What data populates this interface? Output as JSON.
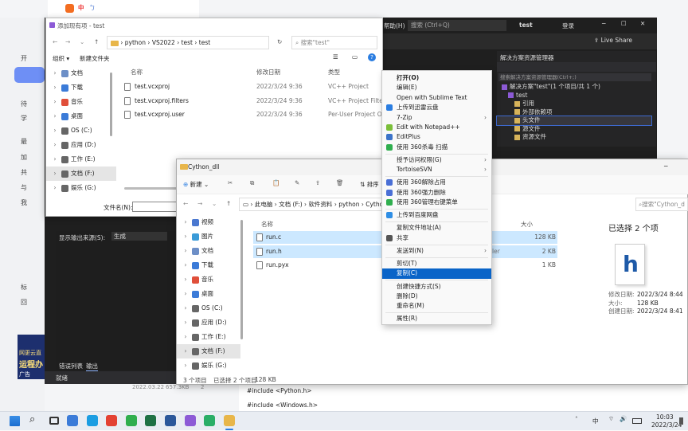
{
  "background_app": {
    "search_tab_labels": [
      "中",
      "ㄅ"
    ],
    "left_items": [
      "开",
      "待",
      "学",
      "最",
      "加",
      "共",
      "与",
      "我",
      "标",
      "回"
    ],
    "bottom_list": {
      "date": "2022.03.22",
      "size": "657.3KB",
      "count": "2"
    },
    "ad": {
      "line1": "网更云直",
      "line2": "运程办",
      "tag": "广告"
    },
    "code_lines": [
      "#include <Python.h>",
      "#include <Windows.h>"
    ]
  },
  "vs": {
    "menu_help": "帮助(H)",
    "search_placeholder": "搜索 (Ctrl+Q)",
    "solution_name": "test",
    "login": "登录",
    "live_share": "Live Share",
    "solution_explorer": {
      "title": "解决方案资源管理器",
      "search_placeholder": "搜索解决方案资源管理器(Ctrl+;)",
      "tree": [
        {
          "label": "解决方案\"test\"(1 个项目/共 1 个)",
          "indent": 0,
          "selected": false
        },
        {
          "label": "test",
          "indent": 1,
          "selected": false
        },
        {
          "label": "引用",
          "indent": 2,
          "selected": false
        },
        {
          "label": "外部依赖项",
          "indent": 2,
          "selected": false
        },
        {
          "label": "头文件",
          "indent": 2,
          "selected": true
        },
        {
          "label": "源文件",
          "indent": 2,
          "selected": false
        },
        {
          "label": "资源文件",
          "indent": 2,
          "selected": false
        }
      ]
    },
    "output": {
      "source_label": "显示输出来源(S):",
      "source_value": "生成",
      "tab_errors": "错误列表",
      "tab_output": "输出",
      "status": "就绪"
    }
  },
  "add_dialog": {
    "title": "添加现有项 - test",
    "path": [
      "python",
      "VS2022",
      "test",
      "test"
    ],
    "search_placeholder": "搜索\"test\"",
    "organize": "组织 ▾",
    "new_folder": "新建文件夹",
    "columns": {
      "name": "名称",
      "modified": "修改日期",
      "type": "类型"
    },
    "files": [
      {
        "name": "test.vcxproj",
        "modified": "2022/3/24 9:36",
        "type": "VC++ Project"
      },
      {
        "name": "test.vcxproj.filters",
        "modified": "2022/3/24 9:36",
        "type": "VC++ Project Filter..."
      },
      {
        "name": "test.vcxproj.user",
        "modified": "2022/3/24 9:36",
        "type": "Per-User Project O..."
      }
    ],
    "nav": [
      "文档",
      "下载",
      "音乐",
      "桌面",
      "OS (C:)",
      "应用 (D:)",
      "工作 (E:)",
      "文档 (F:)",
      "娱乐 (G:)"
    ],
    "filename_label": "文件名(N):"
  },
  "explorer": {
    "title": "Cython_dll",
    "new_label": "新建",
    "sort_label": "排序",
    "path": [
      "此电脑",
      "文档 (F:)",
      "软件资料",
      "python",
      "Cytho"
    ],
    "search_placeholder": "搜索\"Cython_d",
    "columns": {
      "name": "名称",
      "size": "大小"
    },
    "files": [
      {
        "name": "run.c",
        "size": "128 KB",
        "type": "",
        "selected": true
      },
      {
        "name": "run.h",
        "size": "2 KB",
        "type": "ler",
        "selected": true
      },
      {
        "name": "run.pyx",
        "size": "1 KB",
        "type": "",
        "selected": false
      }
    ],
    "nav": [
      "视频",
      "图片",
      "文档",
      "下载",
      "音乐",
      "桌面",
      "OS (C:)",
      "应用 (D:)",
      "工作 (E:)",
      "文档 (F:)",
      "娱乐 (G:)"
    ],
    "status": {
      "count": "3 个项目",
      "selected": "已选择 2 个项目",
      "size": "128 KB"
    },
    "details": {
      "title": "已选择 2 个项",
      "icon_letter": "h",
      "rows": [
        {
          "label": "修改日期:",
          "value": "2022/3/24 8:44"
        },
        {
          "label": "大小:",
          "value": "128 KB"
        },
        {
          "label": "创建日期:",
          "value": "2022/3/24 8:41"
        }
      ]
    }
  },
  "context_menu": {
    "items": [
      {
        "label": "打开(O)",
        "bold": true,
        "arrow": false,
        "icon": ""
      },
      {
        "label": "编辑(E)",
        "arrow": false,
        "icon": ""
      },
      {
        "label": "Open with Sublime Text",
        "arrow": false,
        "icon": ""
      },
      {
        "label": "上传到迅雷云盘",
        "arrow": false,
        "icon": "#2a7de1"
      },
      {
        "label": "7-Zip",
        "arrow": true,
        "icon": ""
      },
      {
        "label": "Edit with Notepad++",
        "arrow": false,
        "icon": "#7bbf3a"
      },
      {
        "label": "EditPlus",
        "arrow": false,
        "icon": "#3b73c9"
      },
      {
        "label": "使用 360杀毒 扫描",
        "arrow": false,
        "icon": "#2fae4e"
      },
      {
        "sep": true
      },
      {
        "label": "授予访问权限(G)",
        "arrow": true,
        "icon": ""
      },
      {
        "label": "TortoiseSVN",
        "arrow": true,
        "icon": ""
      },
      {
        "sep": true
      },
      {
        "label": "使用 360解除占用",
        "arrow": false,
        "icon": "#4a6fd6"
      },
      {
        "label": "使用 360强力删除",
        "arrow": false,
        "icon": "#4a6fd6"
      },
      {
        "label": "使用 360管理右键菜单",
        "arrow": false,
        "icon": "#2fae4e"
      },
      {
        "sep": true
      },
      {
        "label": "上传到百度网盘",
        "arrow": false,
        "icon": "#2f8ee5"
      },
      {
        "sep": true
      },
      {
        "label": "复制文件地址(A)",
        "arrow": false,
        "icon": ""
      },
      {
        "label": "共享",
        "arrow": false,
        "icon": "#555555"
      },
      {
        "sep": true
      },
      {
        "label": "发送到(N)",
        "arrow": true,
        "icon": ""
      },
      {
        "sep": true
      },
      {
        "label": "剪切(T)",
        "arrow": false,
        "icon": ""
      },
      {
        "label": "复制(C)",
        "arrow": false,
        "icon": "",
        "highlight": true
      },
      {
        "sep": true
      },
      {
        "label": "创建快捷方式(S)",
        "arrow": false,
        "icon": ""
      },
      {
        "label": "删除(D)",
        "arrow": false,
        "icon": ""
      },
      {
        "label": "重命名(M)",
        "arrow": false,
        "icon": ""
      },
      {
        "sep": true
      },
      {
        "label": "属性(R)",
        "arrow": false,
        "icon": ""
      }
    ]
  },
  "taskbar": {
    "time": "10:03",
    "date": "2022/3/24",
    "ime": "中",
    "apps": [
      {
        "name": "widgets",
        "color": "#3b7bd8"
      },
      {
        "name": "edge",
        "color": "#1b9de2"
      },
      {
        "name": "chrome",
        "color": "#e34133"
      },
      {
        "name": "360",
        "color": "#2fae4e"
      },
      {
        "name": "excel",
        "color": "#1e7145"
      },
      {
        "name": "word",
        "color": "#2b579a"
      },
      {
        "name": "vs",
        "color": "#8c5ad6"
      },
      {
        "name": "wechat",
        "color": "#2aae67"
      },
      {
        "name": "explorer",
        "color": "#e8b64a"
      }
    ]
  }
}
